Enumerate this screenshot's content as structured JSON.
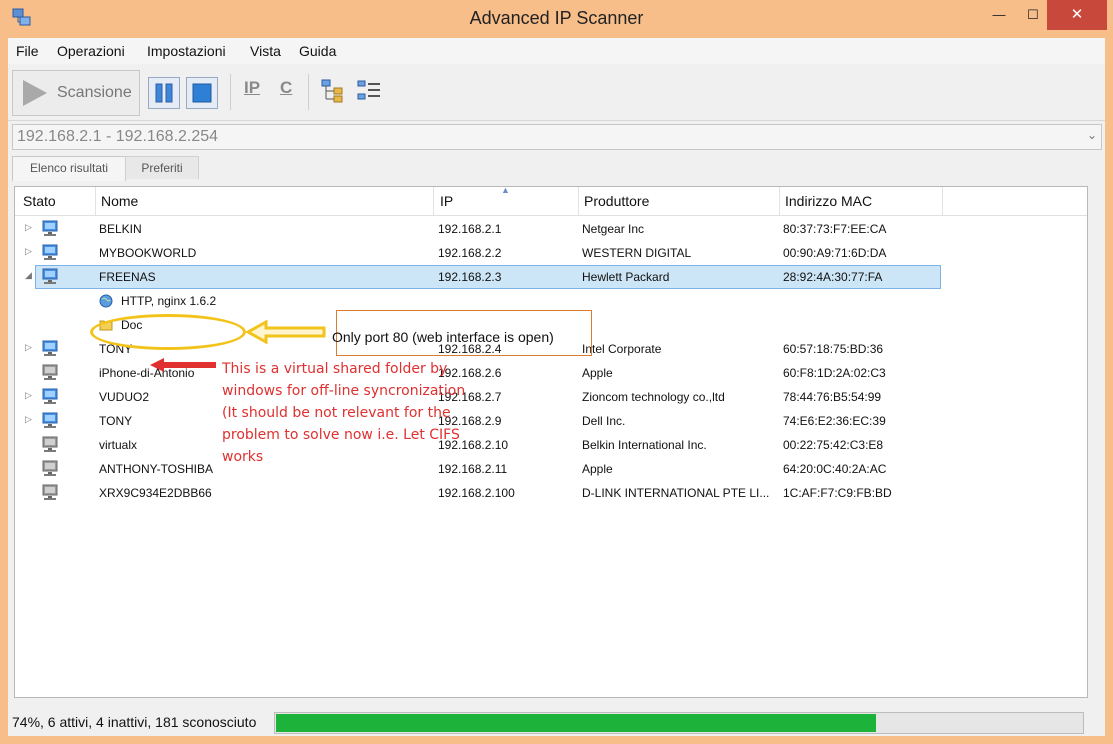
{
  "window": {
    "title": "Advanced IP Scanner",
    "controls": {
      "minimize": "—",
      "maximize": "☐",
      "close": "✕"
    }
  },
  "menu": [
    "File",
    "Operazioni",
    "Impostazioni",
    "Vista",
    "Guida"
  ],
  "toolbar": {
    "scan_label": "Scansione",
    "ip_glyph": "IP",
    "c_glyph": "C"
  },
  "address": {
    "value": "192.168.2.1 - 192.168.2.254"
  },
  "tabs": [
    "Elenco risultati",
    "Preferiti"
  ],
  "columns": [
    "Stato",
    "Nome",
    "IP",
    "Produttore",
    "Indirizzo MAC"
  ],
  "rows": [
    {
      "name": "BELKIN",
      "ip": "192.168.2.1",
      "vendor": "Netgear Inc",
      "mac": "80:37:73:F7:EE:CA",
      "expandable": true,
      "online": true
    },
    {
      "name": "MYBOOKWORLD",
      "ip": "192.168.2.2",
      "vendor": "WESTERN DIGITAL",
      "mac": "00:90:A9:71:6D:DA",
      "expandable": true,
      "online": true
    },
    {
      "name": "FREENAS",
      "ip": "192.168.2.3",
      "vendor": "Hewlett Packard",
      "mac": "28:92:4A:30:77:FA",
      "expandable": true,
      "online": true,
      "selected": true
    },
    {
      "child": true,
      "icon": "globe-icon",
      "name": "HTTP, nginx 1.6.2"
    },
    {
      "child": true,
      "icon": "folder-icon",
      "name": "Doc"
    },
    {
      "name": "TONY",
      "ip": "192.168.2.4",
      "vendor": "Intel Corporate",
      "mac": "60:57:18:75:BD:36",
      "expandable": true,
      "online": true
    },
    {
      "name": "iPhone-di-Antonio",
      "ip": "192.168.2.6",
      "vendor": "Apple",
      "mac": "60:F8:1D:2A:02:C3",
      "expandable": false,
      "online": false
    },
    {
      "name": "VUDUO2",
      "ip": "192.168.2.7",
      "vendor": "Zioncom technology co.,ltd",
      "mac": "78:44:76:B5:54:99",
      "expandable": true,
      "online": true
    },
    {
      "name": "TONY",
      "ip": "192.168.2.9",
      "vendor": "Dell Inc.",
      "mac": "74:E6:E2:36:EC:39",
      "expandable": true,
      "online": true
    },
    {
      "name": "virtualx",
      "ip": "192.168.2.10",
      "vendor": "Belkin International Inc.",
      "mac": "00:22:75:42:C3:E8",
      "expandable": false,
      "online": false
    },
    {
      "name": "ANTHONY-TOSHIBA",
      "ip": "192.168.2.11",
      "vendor": "Apple",
      "mac": "64:20:0C:40:2A:AC",
      "expandable": false,
      "online": false
    },
    {
      "name": "XRX9C934E2DBB66",
      "ip": "192.168.2.100",
      "vendor": "D-LINK INTERNATIONAL PTE LI...",
      "mac": "1C:AF:F7:C9:FB:BD",
      "expandable": false,
      "online": false
    }
  ],
  "annotations": {
    "port_note": "Only port 80 (web interface is open)",
    "folder_note": "This is a virtual shared folder by windows for off-line syncronization (It should be not relevant for the problem to solve now i.e. Let CIFS works"
  },
  "status": {
    "text": "74%, 6 attivi, 4 inattivi, 181 sconosciuto",
    "progress": 0.745
  },
  "colors": {
    "titlebar": "#f7be8a",
    "close": "#c9483c",
    "selection": "#cde6f7",
    "progress": "#1db23a",
    "annotation_red": "#e03030",
    "annotation_yellow": "#f2c31b"
  }
}
